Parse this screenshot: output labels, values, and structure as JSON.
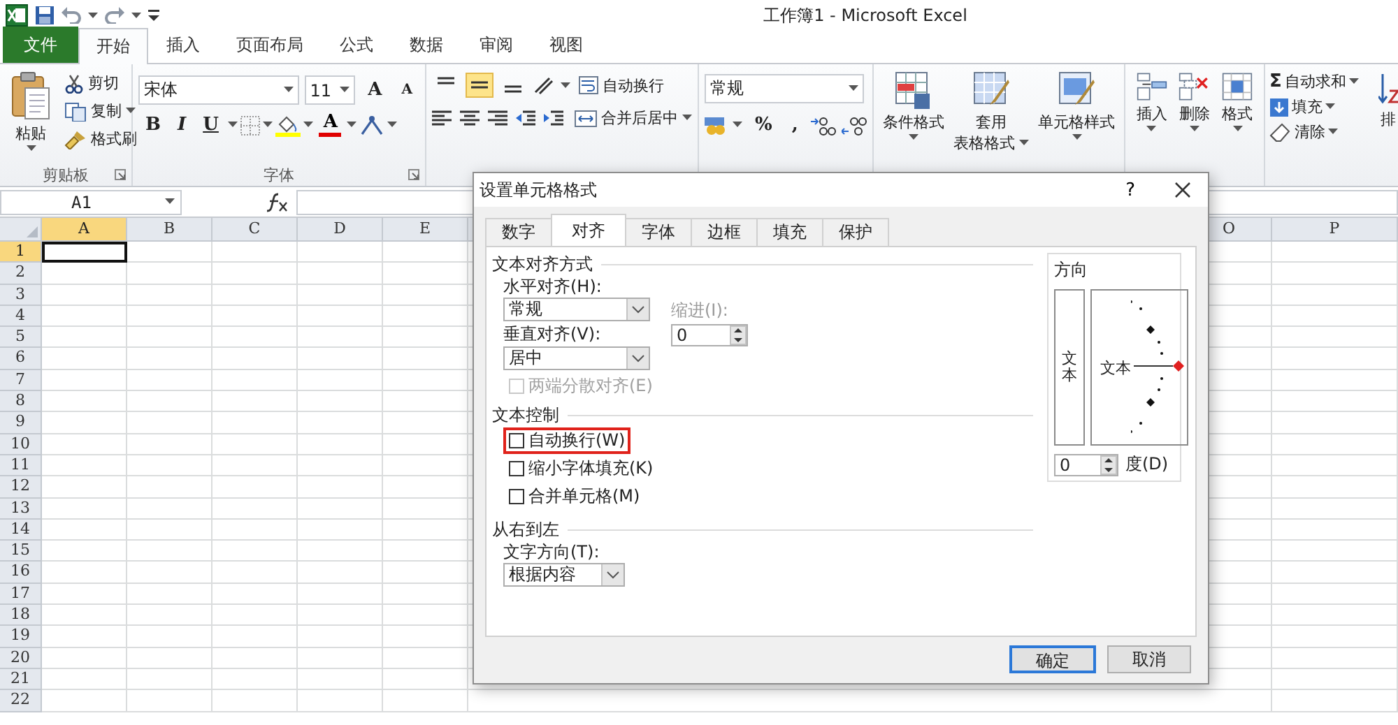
{
  "window": {
    "title": "工作簿1  -  Microsoft Excel"
  },
  "ribbon_tabs": [
    {
      "label": "文件",
      "kind": "file",
      "selected": false
    },
    {
      "label": "开始",
      "kind": "tab",
      "selected": true
    },
    {
      "label": "插入",
      "kind": "tab",
      "selected": false
    },
    {
      "label": "页面布局",
      "kind": "tab",
      "selected": false
    },
    {
      "label": "公式",
      "kind": "tab",
      "selected": false
    },
    {
      "label": "数据",
      "kind": "tab",
      "selected": false
    },
    {
      "label": "审阅",
      "kind": "tab",
      "selected": false
    },
    {
      "label": "视图",
      "kind": "tab",
      "selected": false
    }
  ],
  "ribbon": {
    "clipboard": {
      "label": "剪贴板",
      "paste": "粘贴",
      "tools": [
        "剪切",
        "复制",
        "格式刷"
      ]
    },
    "font": {
      "label": "字体",
      "font_name": "宋体",
      "font_size": "11",
      "grow_glyph": "A",
      "shrink_glyph": "A",
      "format_glyphs": [
        "B",
        "I",
        "U"
      ],
      "color_glyph": "A"
    },
    "alignment": {
      "vertical_buttons": [
        {
          "selected": false
        },
        {
          "selected": true
        },
        {
          "selected": false
        }
      ],
      "wrap_text": "自动换行",
      "merge_center": "合并后居中"
    },
    "number": {
      "format": "常规",
      "percent": "%",
      "comma": ","
    },
    "styles": {
      "buttons": [
        {
          "lines": [
            "条件格式"
          ]
        },
        {
          "lines": [
            "套用",
            "表格格式"
          ]
        },
        {
          "lines": [
            "单元格样式"
          ]
        }
      ]
    },
    "cells": {
      "buttons": [
        "插入",
        "删除",
        "格式"
      ]
    },
    "editing": {
      "sum_glyph": "Σ",
      "items": [
        "自动求和",
        "填充",
        "清除"
      ],
      "sort": "排"
    }
  },
  "formula_bar": {
    "name_box": "A1"
  },
  "sheet": {
    "columns": [
      {
        "label": "A",
        "selected": true,
        "after_gap": false
      },
      {
        "label": "B",
        "selected": false,
        "after_gap": false
      },
      {
        "label": "C",
        "selected": false,
        "after_gap": false
      },
      {
        "label": "D",
        "selected": false,
        "after_gap": false
      },
      {
        "label": "E",
        "selected": false,
        "after_gap": false
      },
      {
        "label": "O",
        "selected": false,
        "after_gap": true
      },
      {
        "label": "P",
        "selected": false,
        "after_gap": false
      }
    ],
    "rows": [
      {
        "label": "1",
        "selected": true
      },
      {
        "label": "2",
        "selected": false
      },
      {
        "label": "3",
        "selected": false
      },
      {
        "label": "4",
        "selected": false
      },
      {
        "label": "5",
        "selected": false
      },
      {
        "label": "6",
        "selected": false
      },
      {
        "label": "7",
        "selected": false
      },
      {
        "label": "8",
        "selected": false
      },
      {
        "label": "9",
        "selected": false
      },
      {
        "label": "10",
        "selected": false
      },
      {
        "label": "11",
        "selected": false
      },
      {
        "label": "12",
        "selected": false
      },
      {
        "label": "13",
        "selected": false
      },
      {
        "label": "14",
        "selected": false
      },
      {
        "label": "15",
        "selected": false
      },
      {
        "label": "16",
        "selected": false
      },
      {
        "label": "17",
        "selected": false
      },
      {
        "label": "18",
        "selected": false
      },
      {
        "label": "19",
        "selected": false
      },
      {
        "label": "20",
        "selected": false
      },
      {
        "label": "21",
        "selected": false
      },
      {
        "label": "22",
        "selected": false
      }
    ]
  },
  "dialog": {
    "title": "设置单元格格式",
    "help": "?",
    "tabs": [
      {
        "label": "数字",
        "selected": false
      },
      {
        "label": "对齐",
        "selected": true
      },
      {
        "label": "字体",
        "selected": false
      },
      {
        "label": "边框",
        "selected": false
      },
      {
        "label": "填充",
        "selected": false
      },
      {
        "label": "保护",
        "selected": false
      }
    ],
    "sections": [
      {
        "kind": "alignment",
        "title": "文本对齐方式",
        "horizontal": {
          "label": "水平对齐(H):",
          "value": "常规"
        },
        "indent": {
          "label": "缩进(I):",
          "value": "0",
          "disabled": true
        },
        "vertical": {
          "label": "垂直对齐(V):",
          "value": "居中"
        },
        "distributed": {
          "label": "两端分散对齐(E)",
          "checked": false,
          "disabled": true
        }
      },
      {
        "kind": "control",
        "title": "文本控制",
        "options": [
          {
            "label": "自动换行(W)",
            "checked": false,
            "highlighted": true
          },
          {
            "label": "缩小字体填充(K)",
            "checked": false,
            "highlighted": false
          },
          {
            "label": "合并单元格(M)",
            "checked": false,
            "highlighted": false
          }
        ]
      },
      {
        "kind": "direction",
        "title": "从右到左",
        "direction": {
          "label": "文字方向(T):",
          "value": "根据内容"
        }
      }
    ],
    "orientation": {
      "title": "方向",
      "vertical_text": "文本",
      "dial_text": "文本",
      "degrees": "0",
      "degrees_label": "度(D)"
    },
    "buttons": [
      {
        "label": "确定",
        "default": true
      },
      {
        "label": "取消",
        "default": false
      }
    ]
  }
}
